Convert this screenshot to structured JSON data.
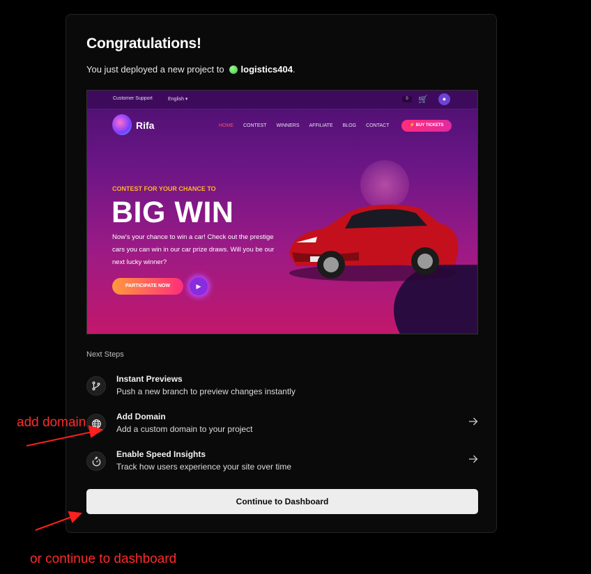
{
  "card": {
    "title": "Congratulations!",
    "subtitle_prefix": "You just deployed a new project to",
    "project_name": "logistics404",
    "subtitle_suffix": "."
  },
  "preview": {
    "top_support": "Customer Support",
    "top_language": "English",
    "cart_count": "0",
    "brand": "Rifa",
    "nav": [
      "HOME",
      "CONTEST",
      "WINNERS",
      "AFFILIATE",
      "BLOG",
      "CONTACT"
    ],
    "buy_label": "BUY TICKETS",
    "kicker": "CONTEST FOR YOUR CHANCE TO",
    "headline": "BIG WIN",
    "description": "Now's your chance to win a car! Check out the prestige cars you can win in our car prize draws. Will you be our next lucky winner?",
    "cta": "PARTICIPATE NOW"
  },
  "next_steps": {
    "label": "Next Steps",
    "items": [
      {
        "title": "Instant Previews",
        "desc": "Push a new branch to preview changes instantly",
        "icon": "git-branch-icon"
      },
      {
        "title": "Add Domain",
        "desc": "Add a custom domain to your project",
        "icon": "globe-icon"
      },
      {
        "title": "Enable Speed Insights",
        "desc": "Track how users experience your site over time",
        "icon": "stopwatch-icon"
      }
    ]
  },
  "continue_label": "Continue to Dashboard",
  "annotations": {
    "add_domain": "add domain",
    "continue": "or continue to dashboard"
  },
  "colors": {
    "accent_annotation": "#ff2a2a",
    "card_bg": "#0a0a0a",
    "button_bg": "#ededed"
  }
}
